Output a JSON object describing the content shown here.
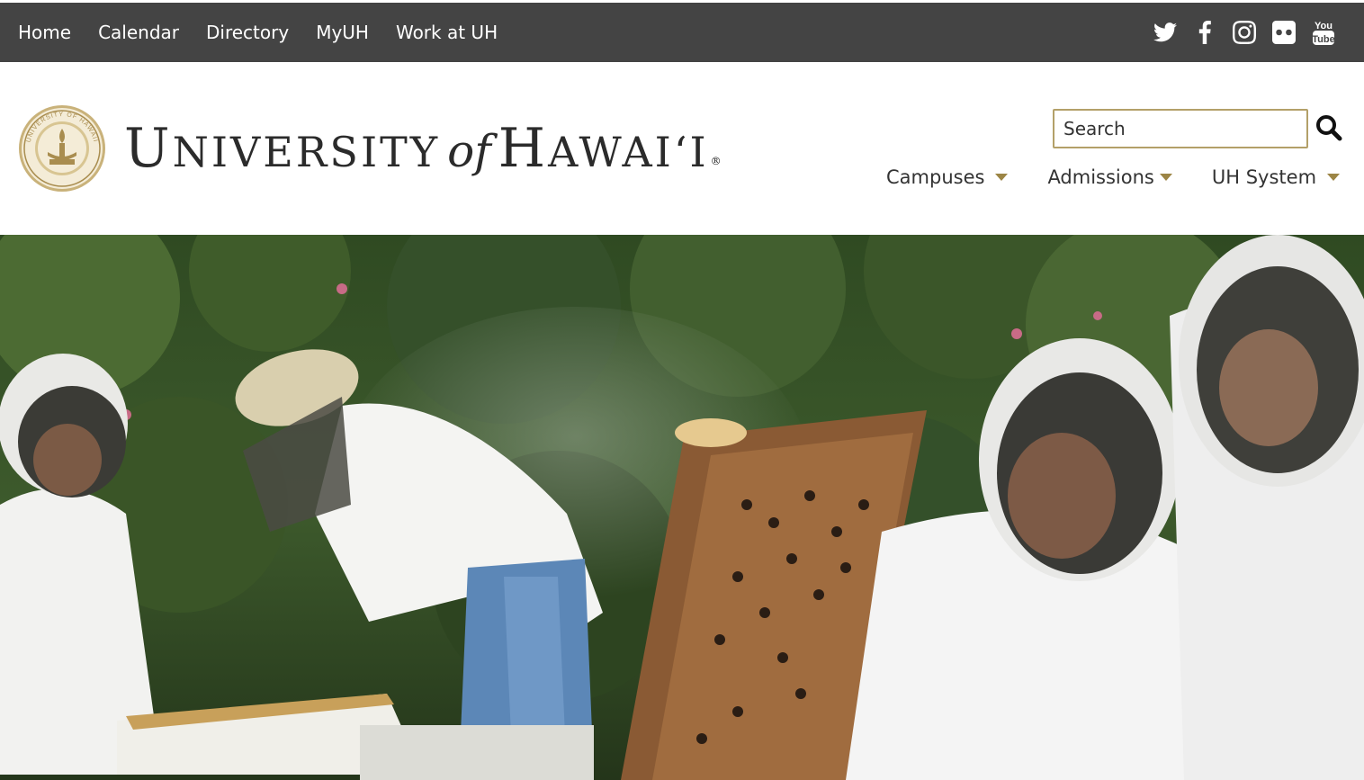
{
  "topnav": {
    "links": [
      "Home",
      "Calendar",
      "Directory",
      "MyUH",
      "Work at UH"
    ]
  },
  "social": {
    "icons": [
      "twitter-icon",
      "facebook-icon",
      "instagram-icon",
      "flickr-icon",
      "youtube-icon"
    ],
    "youtube_top": "You",
    "youtube_bottom": "Tube"
  },
  "brand": {
    "name_parts": [
      "U",
      "NIVERSITY",
      "of",
      "H",
      "AWAI‘I",
      "®"
    ],
    "seal_text": "UNIVERSITY OF HAWAII"
  },
  "search": {
    "placeholder": "Search"
  },
  "mainnav": {
    "items": [
      "Campuses",
      "Admissions",
      "UH System"
    ]
  },
  "colors": {
    "topbar": "#444444",
    "gold": "#9c8545",
    "search_border": "#b3a069"
  },
  "hero": {
    "description_icon": "beekeepers-photo"
  }
}
